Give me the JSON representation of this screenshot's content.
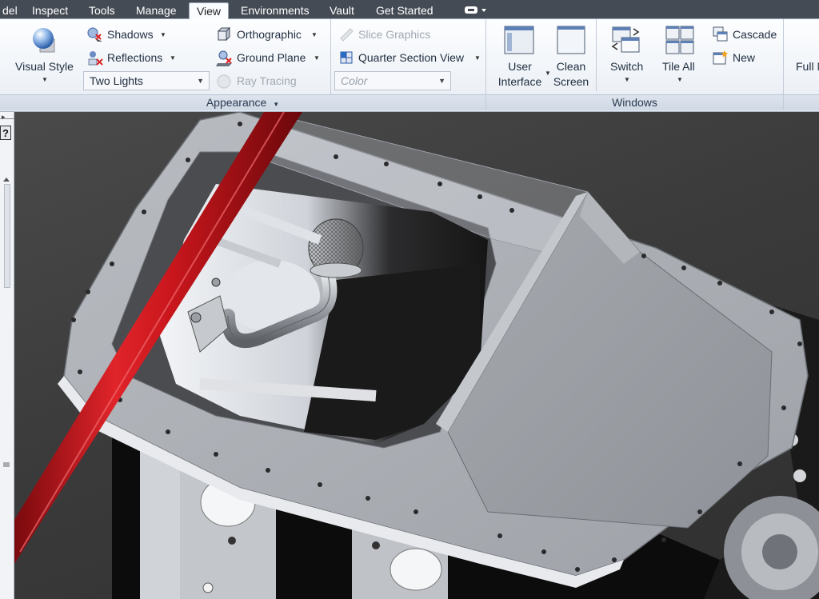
{
  "tabs": [
    {
      "label": "del",
      "active": false
    },
    {
      "label": "Inspect",
      "active": false
    },
    {
      "label": "Tools",
      "active": false
    },
    {
      "label": "Manage",
      "active": false
    },
    {
      "label": "View",
      "active": true
    },
    {
      "label": "Environments",
      "active": false
    },
    {
      "label": "Vault",
      "active": false
    },
    {
      "label": "Get Started",
      "active": false
    }
  ],
  "appearance": {
    "visual_style": "Visual Style",
    "shadows": "Shadows",
    "reflections": "Reflections",
    "lighting_value": "Two Lights",
    "orthographic": "Orthographic",
    "ground_plane": "Ground Plane",
    "ray_tracing": "Ray Tracing",
    "slice_graphics": "Slice Graphics",
    "quarter_section": "Quarter Section View",
    "color_value": "Color",
    "panel_title": "Appearance"
  },
  "windows": {
    "user_interface_line1": "User",
    "user_interface_line2": "Interface",
    "clean_screen_line1": "Clean",
    "clean_screen_line2": "Screen",
    "switch": "Switch",
    "tile_all": "Tile All",
    "cascade": "Cascade",
    "new": "New",
    "panel_title": "Windows"
  },
  "navigate": {
    "full_label": "Full N"
  },
  "colors": {
    "tabbar_bg": "#454b55",
    "ribbon_bg": "#f4f7fb",
    "accent_blue": "#2b6cc4",
    "rod_red": "#c8161c",
    "model_gray": "#a9adb3"
  }
}
